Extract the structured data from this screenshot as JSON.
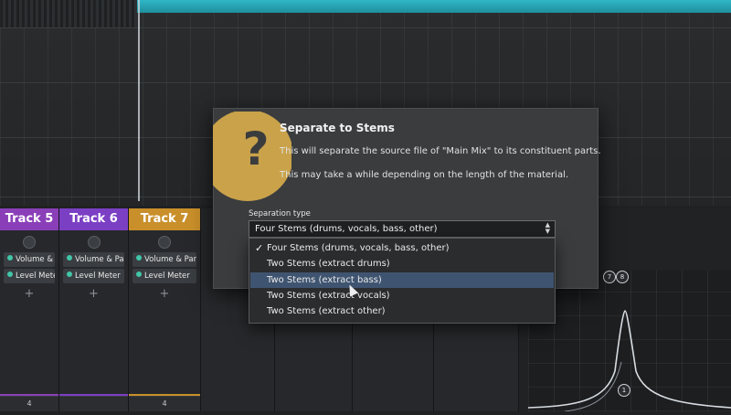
{
  "tracks": [
    {
      "name": "Track 5",
      "color": "#8a3fb8",
      "plugins": [
        "Volume & Pan Plugin",
        "Level Meter"
      ],
      "foot": "4"
    },
    {
      "name": "Track 6",
      "color": "#7b3fc4",
      "plugins": [
        "Volume & Pan Plugin",
        "Level Meter"
      ],
      "foot": ""
    },
    {
      "name": "Track 7",
      "color": "#c98f2a",
      "plugins": [
        "Volume & Pan Plugin",
        "Level Meter"
      ],
      "foot": "4"
    }
  ],
  "dialog": {
    "title": "Separate to Stems",
    "line1": "This will separate the source file of \"Main Mix\" to its constituent parts.",
    "line2": "This may take a while depending on the length of the material.",
    "icon": "question-icon",
    "separation_label": "Separation type",
    "selected": "Four Stems (drums, vocals, bass, other)",
    "options": [
      "Four Stems (drums, vocals, bass, other)",
      "Two Stems (extract drums)",
      "Two Stems (extract bass)",
      "Two Stems (extract vocals)",
      "Two Stems (extract other)"
    ]
  },
  "eq_nodes": [
    "1",
    "7",
    "8"
  ]
}
